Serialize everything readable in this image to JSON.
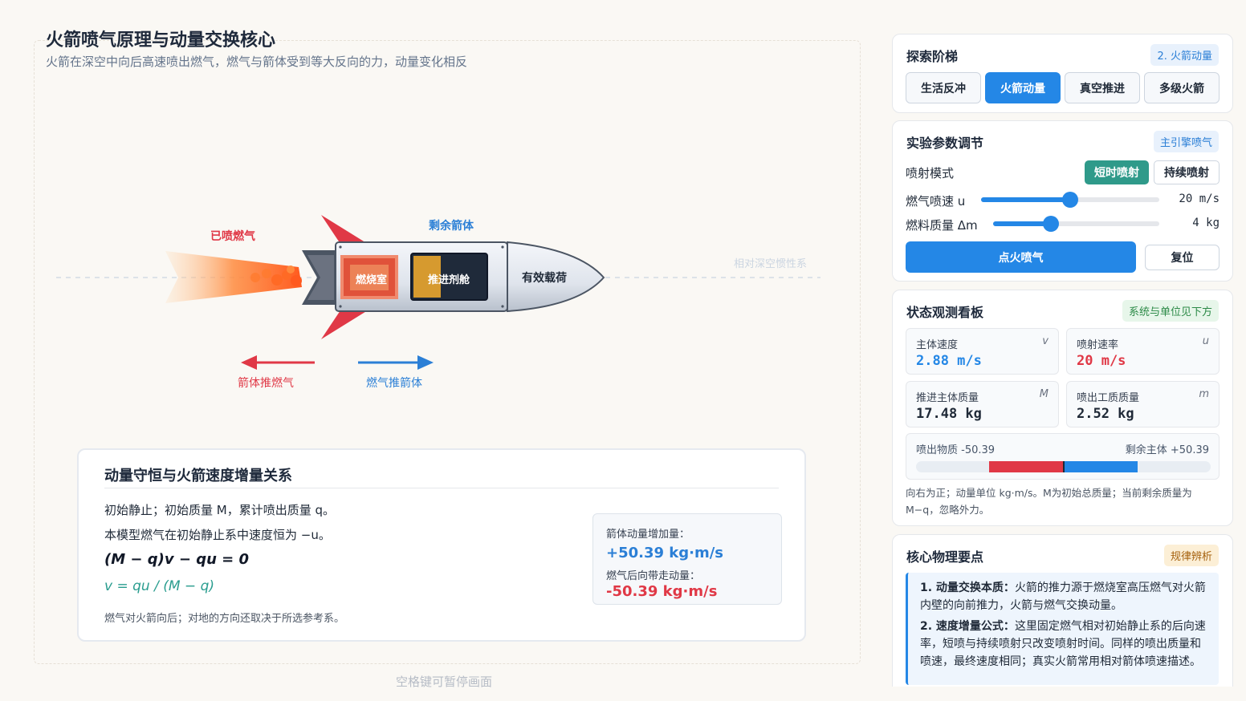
{
  "page": {
    "title": "火箭喷气原理与动量交换核心",
    "subtitle": "火箭在深空中向后高速喷出燃气，燃气与箭体受到等大反向的力，动量变化相反",
    "frame_label": "相对深空惯性系",
    "pause_hint": "空格键可暂停画面"
  },
  "scene": {
    "exhaust_label": "已喷燃气",
    "body_label": "剩余箭体",
    "chamber_label": "燃烧室",
    "propellant_label": "推进剂舱",
    "payload_label": "有效载荷",
    "force_left_label": "箭体推燃气",
    "force_right_label": "燃气推箭体",
    "colors": {
      "red": "#e03846",
      "blue": "#2b7fd6"
    }
  },
  "formula": {
    "title": "动量守恒与火箭速度增量关系",
    "line1": "初始静止；初始质量 M，累计喷出质量 q。",
    "line2": "本模型燃气在初始静止系中速度恒为 −u。",
    "eq1": "(M − q)v − qu = 0",
    "eq2": "v = qu / (M − q)",
    "note": "燃气对火箭向后；对地的方向还取决于所选参考系。",
    "box": {
      "gain_label": "箭体动量增加量：",
      "gain_value": "+50.39 kg·m/s",
      "loss_label": "燃气后向带走动量：",
      "loss_value": "-50.39 kg·m/s"
    }
  },
  "ladder": {
    "title": "探索阶梯",
    "badge": "2. 火箭动量",
    "steps": [
      "生活反冲",
      "火箭动量",
      "真空推进",
      "多级火箭"
    ],
    "active_index": 1
  },
  "params": {
    "title": "实验参数调节",
    "badge": "主引擎喷气",
    "mode_label": "喷射模式",
    "mode_short": "短时喷射",
    "mode_continuous": "持续喷射",
    "speed_label": "燃气喷速 u",
    "speed_value": "20 m/s",
    "speed_fraction": 0.5,
    "mass_label": "燃料质量 Δm",
    "mass_value": "4 kg",
    "mass_fraction": 0.35,
    "ignite_label": "点火喷气",
    "reset_label": "复位"
  },
  "status": {
    "title": "状态观测看板",
    "badge": "系统与单位见下方",
    "metrics": [
      {
        "label": "主体速度",
        "sym": "v",
        "value": "2.88 m/s",
        "color": "#2487e6"
      },
      {
        "label": "喷射速率",
        "sym": "u",
        "value": "20 m/s",
        "color": "#e03846"
      },
      {
        "label": "推进主体质量",
        "sym": "M",
        "value": "17.48 kg",
        "color": "#1f2937"
      },
      {
        "label": "喷出工质质量",
        "sym": "m",
        "value": "2.52 kg",
        "color": "#1f2937"
      }
    ],
    "momentum_left": "喷出物质 -50.39",
    "momentum_right": "剩余主体 +50.39",
    "momentum_left_value": -50.39,
    "momentum_right_value": 50.39,
    "note": "向右为正；动量单位 kg·m/s。M为初始总质量；当前剩余质量为 M−q，忽略外力。"
  },
  "core": {
    "title": "核心物理要点",
    "badge": "规律辨析",
    "points": [
      {
        "head": "1. 动量交换本质：",
        "body": "火箭的推力源于燃烧室高压燃气对火箭内壁的向前推力，火箭与燃气交换动量。"
      },
      {
        "head": "2. 速度增量公式：",
        "body": "这里固定燃气相对初始静止系的后向速率，短喷与持续喷射只改变喷射时间。同样的喷出质量和喷速，最终速度相同；真实火箭常用相对箭体喷速描述。"
      }
    ]
  }
}
